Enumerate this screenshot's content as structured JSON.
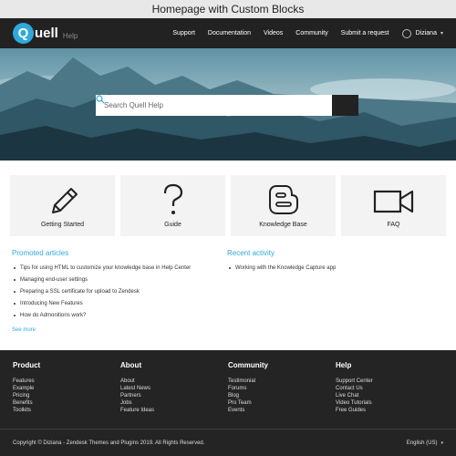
{
  "caption": "Homepage with Custom Blocks",
  "header": {
    "logo_letter": "Q",
    "logo_rest": "uell",
    "logo_suffix": "Help",
    "nav": [
      "Support",
      "Documentation",
      "Videos",
      "Community",
      "Submit a request"
    ],
    "user_name": "Diziana",
    "user_caret": "▾"
  },
  "hero": {
    "search_placeholder": "Search Quell Help"
  },
  "cards": [
    {
      "label": "Getting Started",
      "icon": "pencil-icon"
    },
    {
      "label": "Guide",
      "icon": "question-mark-icon"
    },
    {
      "label": "Knowledge Base",
      "icon": "blogger-icon"
    },
    {
      "label": "FAQ",
      "icon": "video-camera-icon"
    }
  ],
  "promoted": {
    "title": "Promoted articles",
    "items": [
      "Tips for using HTML to customize your knowledge base in Help Center",
      "Managing end-user settings",
      "Preparing a SSL certificate for upload to Zendesk",
      "Introducing New Features",
      "How do Admonitions work?"
    ],
    "see_more": "See more"
  },
  "recent": {
    "title": "Recent activity",
    "items": [
      "Working with the Knowledge Capture app"
    ]
  },
  "footer": {
    "columns": [
      {
        "title": "Product",
        "links": [
          "Features",
          "Example",
          "Pricing",
          "Benefits",
          "Toolkits"
        ]
      },
      {
        "title": "About",
        "links": [
          "About",
          "Latest News",
          "Partners",
          "Jobs",
          "Feature Ideas"
        ]
      },
      {
        "title": "Community",
        "links": [
          "Testimonial",
          "Forums",
          "Blog",
          "Pro Team",
          "Events"
        ]
      },
      {
        "title": "Help",
        "links": [
          "Support Center",
          "Contact Us",
          "Live Chat",
          "Video Tutorials",
          "Free Guides"
        ]
      }
    ],
    "copyright": "Copyright © Diziana - Zendesk Themes and Plugins 2019. All Rights Reserved.",
    "language": "English (US)",
    "language_caret": "▾"
  },
  "colors": {
    "accent": "#2fa9dc",
    "header_bg": "#222222",
    "footer_bg": "#242424"
  }
}
